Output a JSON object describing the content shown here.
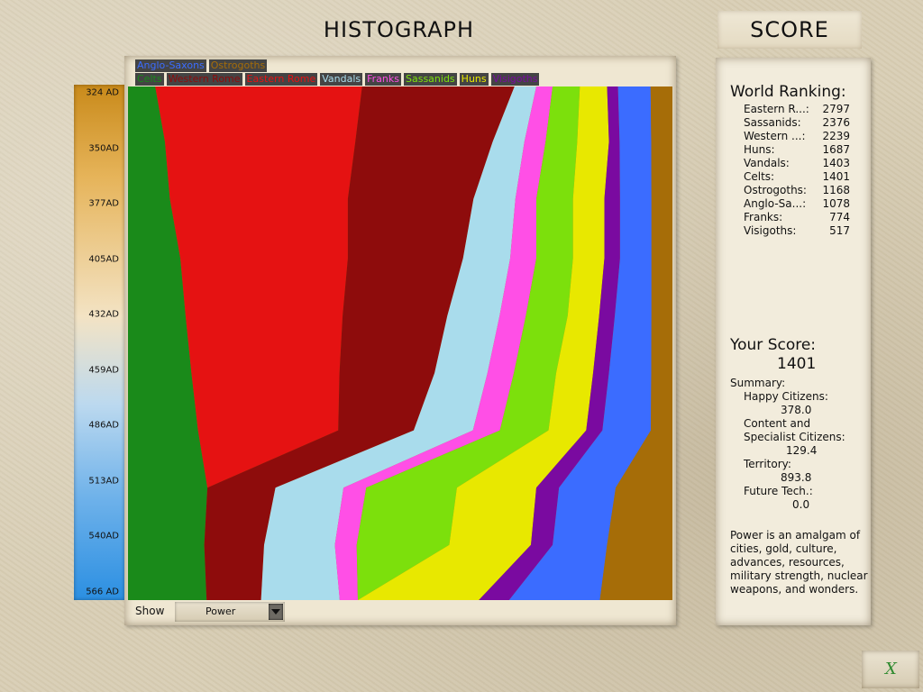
{
  "header": {
    "title": "HISTOGRAPH",
    "score_title": "SCORE"
  },
  "legend": {
    "row1": [
      {
        "label": "Anglo-Saxons",
        "color": "#3b6cff"
      },
      {
        "label": "Ostrogoths",
        "color": "#a66d08"
      }
    ],
    "row2": [
      {
        "label": "Celts",
        "color": "#1a8a1a"
      },
      {
        "label": "Western Rome",
        "color": "#8e0c0c"
      },
      {
        "label": "Eastern Rome",
        "color": "#e51212"
      },
      {
        "label": "Vandals",
        "color": "#a9dcec"
      },
      {
        "label": "Franks",
        "color": "#ff4fe6"
      },
      {
        "label": "Sassanids",
        "color": "#7ce00c"
      },
      {
        "label": "Huns",
        "color": "#e8e800"
      },
      {
        "label": "Visigoths",
        "color": "#7a0aa0"
      }
    ]
  },
  "timeline": {
    "ticks": [
      "324 AD",
      "350AD",
      "377AD",
      "405AD",
      "432AD",
      "459AD",
      "486AD",
      "513AD",
      "540AD",
      "566 AD"
    ]
  },
  "chart_data": {
    "type": "area",
    "stacked": true,
    "normalized": true,
    "x_axis": "time",
    "x": [
      324,
      350,
      377,
      405,
      432,
      459,
      486,
      513,
      540,
      566
    ],
    "series": [
      {
        "name": "Celts",
        "color": "#1a8a1a",
        "values": [
          5,
          7,
          8,
          10,
          11,
          12,
          13,
          14,
          14,
          13
        ]
      },
      {
        "name": "Eastern Rome",
        "color": "#e51212",
        "values": [
          38,
          36,
          34,
          32,
          30,
          28,
          26,
          0,
          0,
          0
        ]
      },
      {
        "name": "Western Rome",
        "color": "#8e0c0c",
        "values": [
          28,
          26,
          24,
          22,
          20,
          18,
          14,
          12,
          11,
          9
        ]
      },
      {
        "name": "Vandals",
        "color": "#a9dcec",
        "values": [
          4,
          6,
          8,
          9,
          10,
          10,
          11,
          12,
          13,
          13
        ]
      },
      {
        "name": "Franks",
        "color": "#ff4fe6",
        "values": [
          3,
          4,
          4,
          5,
          5,
          5,
          5,
          4,
          4,
          3
        ]
      },
      {
        "name": "Sassanids",
        "color": "#7ce00c",
        "values": [
          5,
          6,
          7,
          7,
          8,
          8,
          9,
          16,
          17,
          0
        ]
      },
      {
        "name": "Huns",
        "color": "#e8e800",
        "values": [
          5,
          6,
          6,
          6,
          6,
          7,
          7,
          14,
          15,
          20
        ]
      },
      {
        "name": "Visigoths",
        "color": "#7a0aa0",
        "values": [
          2,
          2,
          3,
          3,
          3,
          3,
          3,
          4,
          4,
          5
        ]
      },
      {
        "name": "Anglo-Saxons",
        "color": "#3b6cff",
        "values": [
          6,
          6,
          6,
          6,
          7,
          8,
          9,
          10,
          10,
          15
        ]
      },
      {
        "name": "Ostrogoths",
        "color": "#a66d08",
        "values": [
          4,
          4,
          4,
          4,
          4,
          4,
          4,
          10,
          12,
          12
        ]
      }
    ]
  },
  "show": {
    "label": "Show",
    "value": "Power"
  },
  "ranking": {
    "title": "World Ranking:",
    "items": [
      {
        "name": "Eastern R...:",
        "score": "2797"
      },
      {
        "name": "Sassanids:",
        "score": "2376"
      },
      {
        "name": "Western ...:",
        "score": "2239"
      },
      {
        "name": "Huns:",
        "score": "1687"
      },
      {
        "name": "Vandals:",
        "score": "1403"
      },
      {
        "name": "Celts:",
        "score": "1401"
      },
      {
        "name": "Ostrogoths:",
        "score": "1168"
      },
      {
        "name": "Anglo-Sa...:",
        "score": "1078"
      },
      {
        "name": "Franks:",
        "score": "774"
      },
      {
        "name": "Visigoths:",
        "score": "517"
      }
    ]
  },
  "your_score": {
    "title": "Your Score:",
    "value": "1401",
    "summary_label": "Summary:",
    "happy_label": "Happy Citizens:",
    "happy_value": "378.0",
    "content_label_1": "Content and",
    "content_label_2": "Specialist Citizens:",
    "content_value": "129.4",
    "territory_label": "Territory:",
    "territory_value": "893.8",
    "future_label": "Future Tech.:",
    "future_value": "0.0"
  },
  "note": "Power is an amalgam of cities, gold, culture, advances, resources, military strength, nuclear weapons, and wonders.",
  "close_button": {
    "label": "X"
  }
}
